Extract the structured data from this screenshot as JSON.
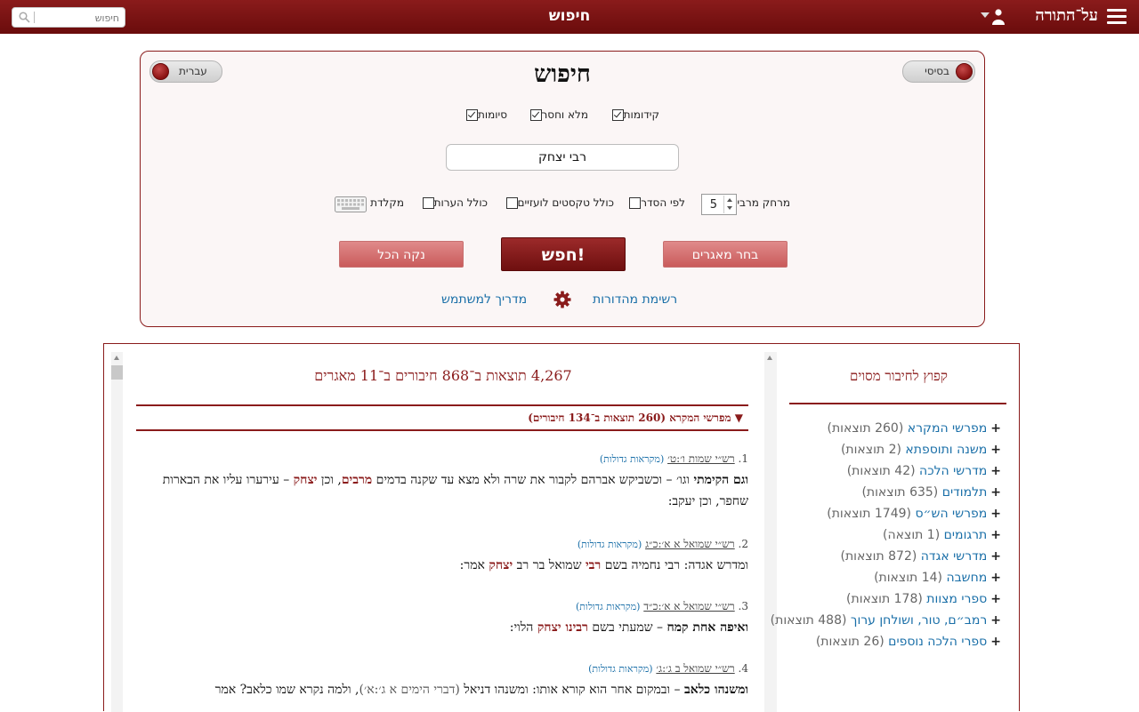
{
  "topbar": {
    "title": "חיפוש",
    "brand": "על־התורה",
    "search_placeholder": "חיפוש"
  },
  "panel": {
    "title": "חיפוש",
    "basic_toggle": "בסיסי",
    "language_toggle": "עברית",
    "options_top": [
      {
        "label": "קידומות",
        "checked": true
      },
      {
        "label": "מלא וחסר",
        "checked": true
      },
      {
        "label": "סיומות",
        "checked": true
      }
    ],
    "query": "רבי יצחק",
    "max_distance_label": "מרחק מרבי:",
    "max_distance_value": "5",
    "options_bottom": [
      {
        "label": "לפי הסדר",
        "checked": false
      },
      {
        "label": "כולל טקסטים לועזיים",
        "checked": false
      },
      {
        "label": "כולל הערות",
        "checked": false
      }
    ],
    "keyboard_label": "מקלדת",
    "btn_choose": "בחר מאגרים",
    "btn_search": "חפש!",
    "btn_clear": "נקה הכל",
    "link_editions": "רשימת מהדורות",
    "link_guide": "מדריך למשתמש"
  },
  "results": {
    "summary": "4,267 תוצאות ב־868 חיבורים ב־11 מאגרים",
    "category": "▼ מפרשי המקרא (260 תוצאות ב־134 חיבורים)",
    "items": [
      {
        "num": "1.",
        "ref": "רש״י שמות ו׳:ט׳",
        "src": "(מקראות גדולות)",
        "bold": "וגם הקימתי",
        "t1": " וגו׳ – וכשביקש אברהם לקבור את שרה ולא מצא עד שקנה בדמים ",
        "h1": "מרבים",
        "t2": ", וכן ",
        "h2": "יצחק",
        "t3": " – עירערו עליו את הבארות שחפר, וכן יעקב:"
      },
      {
        "num": "2.",
        "ref": "רש״י שמואל א א׳:כ״ג",
        "src": "(מקראות גדולות)",
        "t1": "ומדרש אגדה: רבי נחמיה בשם ",
        "h1": "רבי",
        "t2": " שמואל בר רב ",
        "h2": "יצחק",
        "t3": " אמר:"
      },
      {
        "num": "3.",
        "ref": "רש״י שמואל א א׳:כ״ד",
        "src": "(מקראות גדולות)",
        "bold": "ואיפה אחת קמח",
        "t1": " – שמעתי בשם ",
        "h1": "רבינו יצחק",
        "t2": " הלוי:"
      },
      {
        "num": "4.",
        "ref": "רש״י שמואל ב ג׳:ג׳",
        "src": "(מקראות גדולות)",
        "bold": "ומשנהו כלאב",
        "t1": " – ובמקום אחר הוא קורא אותו: ומשנהו דניאל ",
        "dict": "(דברי הימים א ג׳:א׳)",
        "t2": ", ולמה נקרא שמו כלאב? אמר"
      }
    ]
  },
  "side": {
    "title": "קפוץ לחיבור מסוים",
    "items": [
      {
        "name": "מפרשי המקרא",
        "count": "(260 תוצאות)"
      },
      {
        "name": "משנה ותוספתא",
        "count": "(2 תוצאות)"
      },
      {
        "name": "מדרשי הלכה",
        "count": "(42 תוצאות)"
      },
      {
        "name": "תלמודים",
        "count": "(635 תוצאות)"
      },
      {
        "name": "מפרשי הש״ס",
        "count": "(1749 תוצאות)"
      },
      {
        "name": "תרגומים",
        "count": "(1 תוצאה)"
      },
      {
        "name": "מדרשי אגדה",
        "count": "(872 תוצאות)"
      },
      {
        "name": "מחשבה",
        "count": "(14 תוצאות)"
      },
      {
        "name": "ספרי מצוות",
        "count": "(178 תוצאות)"
      },
      {
        "name": "רמב״ם, טור, ושולחן ערוך",
        "count": "(488 תוצאות)"
      },
      {
        "name": "ספרי הלכה נוספים",
        "count": "(26 תוצאות)"
      }
    ]
  },
  "colors": {
    "brand": "#8a1b1b",
    "link": "#1a6fa8"
  }
}
